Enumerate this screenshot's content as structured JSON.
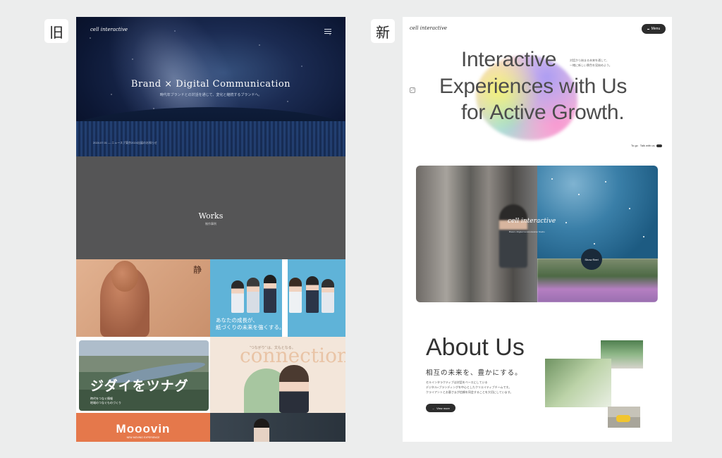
{
  "labels": {
    "old": "旧",
    "new": "新"
  },
  "old_site": {
    "logo": "cell interactive",
    "hero": {
      "title": "Brand × Digital Communication",
      "subtitle": "時代年ブランドとの対話を通じて、変化と継続するブランドへ。",
      "news": "2024.07.01  —  ニュースブ東京2024出展のお知らせ"
    },
    "works": {
      "title": "Works",
      "subtitle": "制作事例"
    },
    "tiles": {
      "calligraphy": "静",
      "staff_copy_1": "あなたの成長が、",
      "staff_copy_2": "紙づくりの未来を強くする。",
      "river_title": "ジダイをツナグ",
      "river_small_1": "時代をつなぐ情報",
      "river_small_2": "地域のつなぐものづくり",
      "faded_big": "connection is",
      "faded_quote": "\"つながり\" は、文もとなる。",
      "mooovin": "Mooovin",
      "mooovin_sub": "NEW MOVING EXPERIENCE"
    }
  },
  "new_site": {
    "logo": "cell interactive",
    "menu_label": "Menu",
    "headline": [
      "Interactive",
      "Experiences with Us",
      "for Active Growth."
    ],
    "side_text": [
      "対話から始まる未来を通して、",
      "一緒に新しい景色を見始めよう。"
    ],
    "talk_label": "Talk with us",
    "talk_prefix": "To go",
    "photo_logo": "cell interactive",
    "photo_logo_sub": "Brand x Digital Communication Studio",
    "show_reel": "Show Reel",
    "about": {
      "title": "About Us",
      "subtitle": "相互の未来を、豊かにする。",
      "body": [
        "セルインタラクティブは対話をベースにしている",
        "デジタル×ブランディングを中心としたクリエイティブチームです。",
        "クライアントとお客さまが信頼を同会することを大切にしています。"
      ],
      "view_more": "View more"
    }
  },
  "colors": {
    "background": "#eceded",
    "old_works_bg": "#555556",
    "mooovin_orange": "#e5784b",
    "staff_blue": "#5fb3d8",
    "new_headline": "#4c4c4c",
    "button_dark": "#2d2d2d"
  }
}
